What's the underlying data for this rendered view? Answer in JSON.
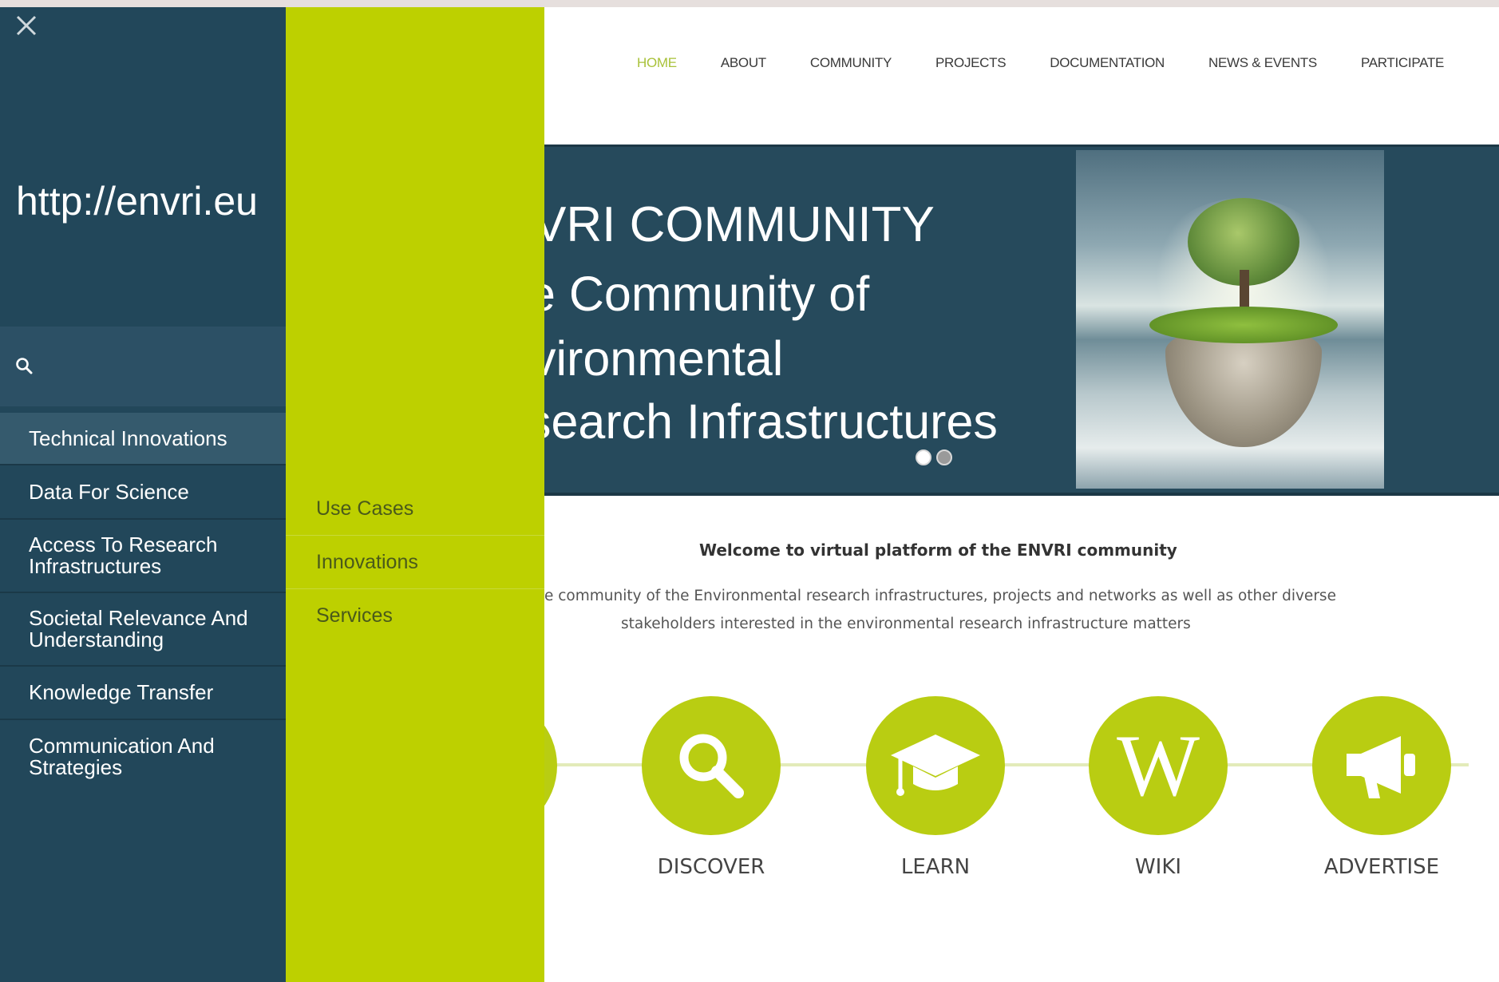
{
  "nav": {
    "items": [
      "HOME",
      "ABOUT",
      "COMMUNITY",
      "PROJECTS",
      "DOCUMENTATION",
      "NEWS & EVENTS",
      "PARTICIPATE"
    ],
    "active": "HOME",
    "active_color": "#a9c23a"
  },
  "hero": {
    "title": "VRI COMMUNITY",
    "subtitle_lines": [
      "e Community of",
      "vironmental",
      "search Infrastructures"
    ],
    "image_icon": "floating-island-tree-image",
    "slides": 2,
    "active_slide": 1,
    "background_color": "#264a5c"
  },
  "welcome": {
    "title": "Welcome to virtual platform of the ENVRI community",
    "text_line1": "e community of the Environmental research infrastructures, projects and networks as well as other diverse",
    "text_line2": "stakeholders interested in the environmental research infrastructure matters"
  },
  "actions": {
    "color": "#b9cd12",
    "items": [
      {
        "label": "DISCOVER",
        "icon": "magnifier-icon"
      },
      {
        "label": "LEARN",
        "icon": "graduation-cap-icon"
      },
      {
        "label": "WIKI",
        "icon": "wikipedia-w-icon",
        "glyph": "W"
      },
      {
        "label": "ADVERTISE",
        "icon": "megaphone-icon"
      }
    ]
  },
  "menu": {
    "close_icon": "close-icon",
    "url": "http://envri.eu",
    "search_icon": "search-icon",
    "search_value": "",
    "panel_color": "#22475a",
    "categories": [
      {
        "label": "Technical Innovations",
        "selected": true
      },
      {
        "label": "Data For Science",
        "selected": false
      },
      {
        "label": "Access To Research Infrastructures",
        "selected": false
      },
      {
        "label": "Societal Relevance And Understanding",
        "selected": false
      },
      {
        "label": "Knowledge Transfer",
        "selected": false
      },
      {
        "label": "Communication And Strategies",
        "selected": false
      }
    ],
    "submenu_color": "#bdd000",
    "submenu": [
      "Use Cases",
      "Innovations",
      "Services"
    ]
  }
}
